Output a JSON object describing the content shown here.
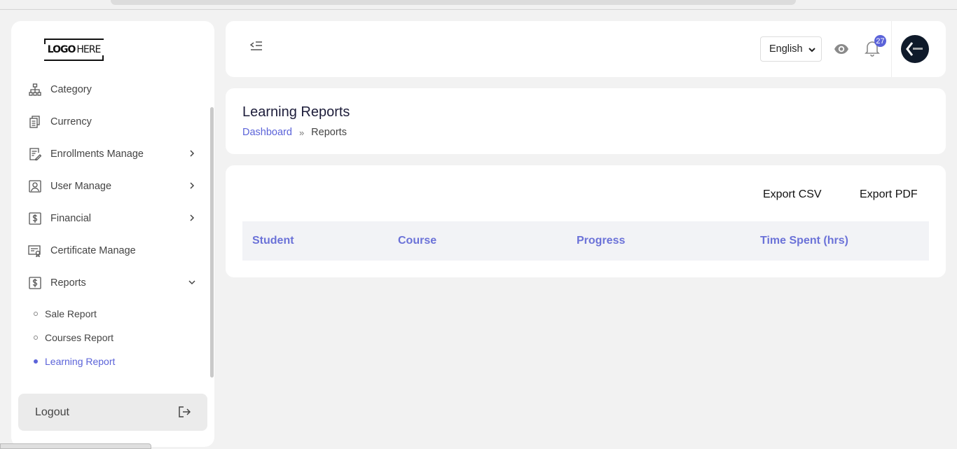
{
  "logo": {
    "bold": "LOGO",
    "light": "HERE"
  },
  "sidebar": {
    "items": [
      {
        "label": "Category"
      },
      {
        "label": "Currency"
      },
      {
        "label": "Enrollments Manage"
      },
      {
        "label": "User Manage"
      },
      {
        "label": "Financial"
      },
      {
        "label": "Certificate Manage"
      },
      {
        "label": "Reports"
      }
    ],
    "subitems": [
      {
        "label": "Sale Report"
      },
      {
        "label": "Courses Report"
      },
      {
        "label": "Learning Report"
      }
    ],
    "logout_label": "Logout"
  },
  "topbar": {
    "language": "English",
    "notification_count": "27"
  },
  "page": {
    "title": "Learning Reports",
    "breadcrumb": {
      "home": "Dashboard",
      "separator": "»",
      "current": "Reports"
    }
  },
  "content": {
    "export_csv": "Export CSV",
    "export_pdf": "Export PDF",
    "columns": [
      "Student",
      "Course",
      "Progress",
      "Time Spent (hrs)"
    ]
  },
  "colors": {
    "accent": "#5b63d9",
    "background": "#f2f2f2"
  }
}
